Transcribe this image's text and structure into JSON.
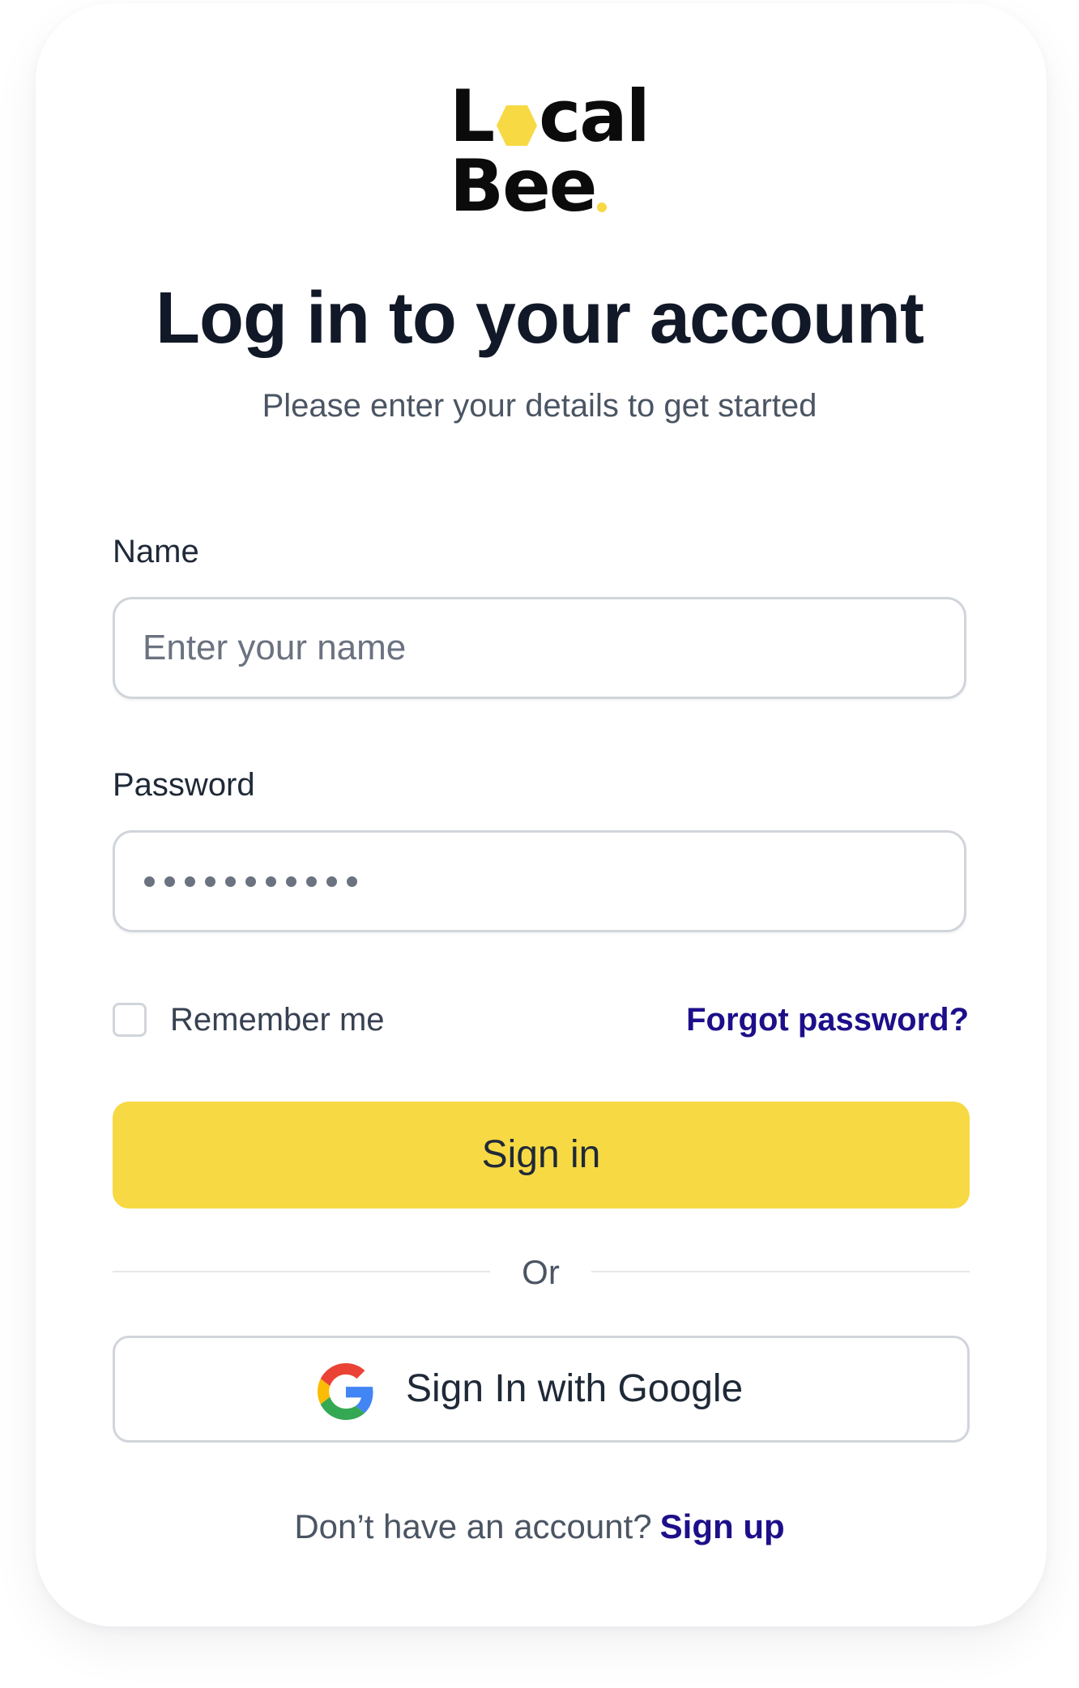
{
  "logo": {
    "line1_start": "L",
    "line1_end": "cal",
    "line2": "Bee",
    "icon": "honeycomb-hexagon",
    "accent_color": "#f7d944"
  },
  "header": {
    "title": "Log in to your account",
    "subtitle": "Please enter your details to get started"
  },
  "form": {
    "name_label": "Name",
    "name_placeholder": "Enter your name",
    "name_value": "",
    "password_label": "Password",
    "password_masked_length": 11,
    "remember_label": "Remember me",
    "remember_checked": false,
    "forgot_label": "Forgot password?",
    "signin_label": "Sign in",
    "divider_label": "Or",
    "google_label": "Sign In with Google",
    "google_icon": "google-g-icon"
  },
  "footer": {
    "prompt": "Don’t have an account?",
    "signup_label": "Sign up"
  },
  "colors": {
    "primary": "#f7d944",
    "link": "#1d0f8a",
    "text": "#111827",
    "muted": "#4b5563",
    "border": "#d1d5db"
  }
}
